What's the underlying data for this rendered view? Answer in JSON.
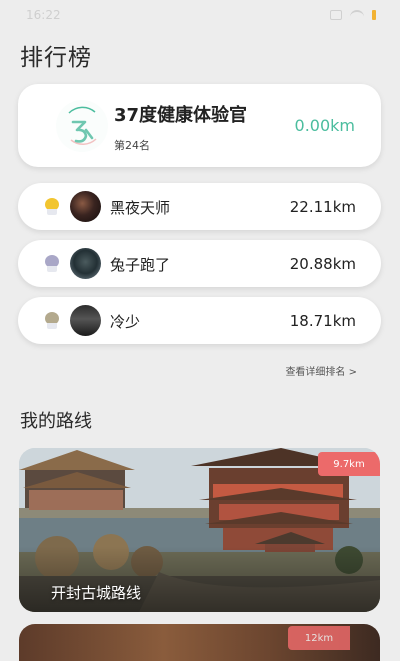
{
  "status_bar": {
    "time": "16:22"
  },
  "page": {
    "title": "排行榜"
  },
  "my_rank": {
    "name": "37度健康体验官",
    "rank": "第24名",
    "distance": "0.00km",
    "accent_color": "#4bbd9e"
  },
  "leaderboard": [
    {
      "name": "黑夜天师",
      "distance": "22.11km",
      "medal": "gold",
      "medal_color": "#f2c530"
    },
    {
      "name": "兔子跑了",
      "distance": "20.88km",
      "medal": "silver",
      "medal_color": "#a9a7c7"
    },
    {
      "name": "冷少",
      "distance": "18.71km",
      "medal": "bronze",
      "medal_color": "#b3a98d"
    }
  ],
  "detail_link": "查看详细排名 >",
  "routes_section": {
    "title": "我的路线"
  },
  "routes": [
    {
      "name": "开封古城路线",
      "distance": "9.7km",
      "badge_color": "#ec6a6a"
    },
    {
      "name": "",
      "distance": "12km",
      "badge_color": "#ec6a6a"
    }
  ]
}
